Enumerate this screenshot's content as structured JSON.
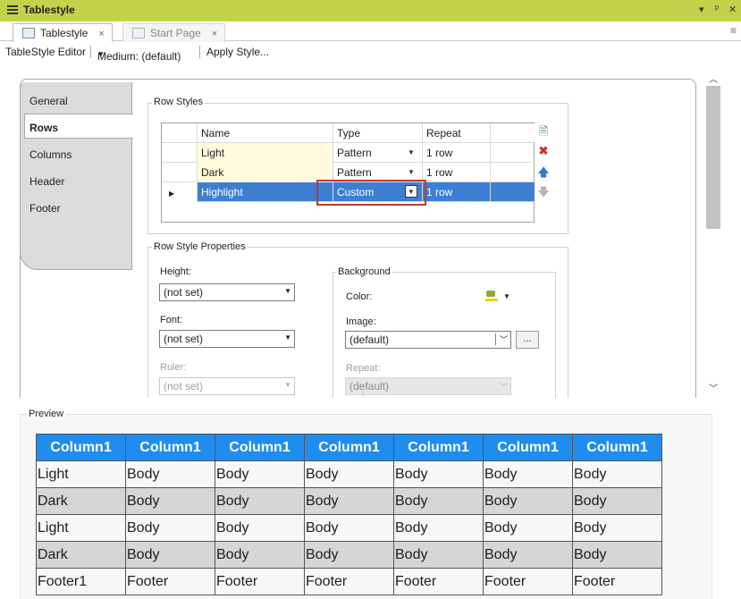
{
  "window": {
    "title": "Tablestyle",
    "controls": {
      "dropdown": "▾",
      "pin": "ᵖ",
      "close": "✕"
    }
  },
  "doc_tabs": [
    {
      "label": "Tablestyle",
      "close": "×"
    },
    {
      "label": "Start Page",
      "close": "×"
    }
  ],
  "toolbar": {
    "editor_label": "TableStyle Editor",
    "style_select": "Medium: (default)",
    "apply_label": "Apply Style..."
  },
  "side_tabs": [
    "General",
    "Rows",
    "Columns",
    "Header",
    "Footer"
  ],
  "row_styles": {
    "group_title": "Row Styles",
    "columns": [
      "Name",
      "Type",
      "Repeat"
    ],
    "rows": [
      {
        "name": "Light",
        "type": "Pattern",
        "repeat": "1 row"
      },
      {
        "name": "Dark",
        "type": "Pattern",
        "repeat": "1 row"
      },
      {
        "name": "Highlight",
        "type": "Custom",
        "repeat": "1 row"
      }
    ],
    "buttons": [
      "add-row-icon",
      "delete-icon",
      "move-up-icon",
      "move-down-icon"
    ]
  },
  "row_style_properties": {
    "group_title": "Row Style Properties",
    "height": {
      "label": "Height:",
      "value": "(not set)"
    },
    "font": {
      "label": "Font:",
      "value": "(not set)"
    },
    "ruler": {
      "label": "Ruler:",
      "value": "(not set)"
    },
    "background": {
      "group_title": "Background",
      "color_label": "Color:",
      "image_label": "Image:",
      "image_value": "(default)",
      "browse_label": "...",
      "repeat_label": "Repeat:",
      "repeat_value": "(default)"
    }
  },
  "preview": {
    "title": "Preview",
    "header": [
      "Column1",
      "Column1",
      "Column1",
      "Column1",
      "Column1",
      "Column1",
      "Column1"
    ],
    "rows": [
      [
        "Light",
        "Body",
        "Body",
        "Body",
        "Body",
        "Body",
        "Body"
      ],
      [
        "Dark",
        "Body",
        "Body",
        "Body",
        "Body",
        "Body",
        "Body"
      ],
      [
        "Light",
        "Body",
        "Body",
        "Body",
        "Body",
        "Body",
        "Body"
      ],
      [
        "Dark",
        "Body",
        "Body",
        "Body",
        "Body",
        "Body",
        "Body"
      ],
      [
        "Footer1",
        "Footer",
        "Footer",
        "Footer",
        "Footer",
        "Footer",
        "Footer"
      ]
    ],
    "header_color": "#1f8df0",
    "dark_row_color": "#d6d6d6"
  },
  "colors": {
    "titlebar": "#c2d34b",
    "selection": "#3d7fd3",
    "highlight_box": "#c0392b"
  }
}
